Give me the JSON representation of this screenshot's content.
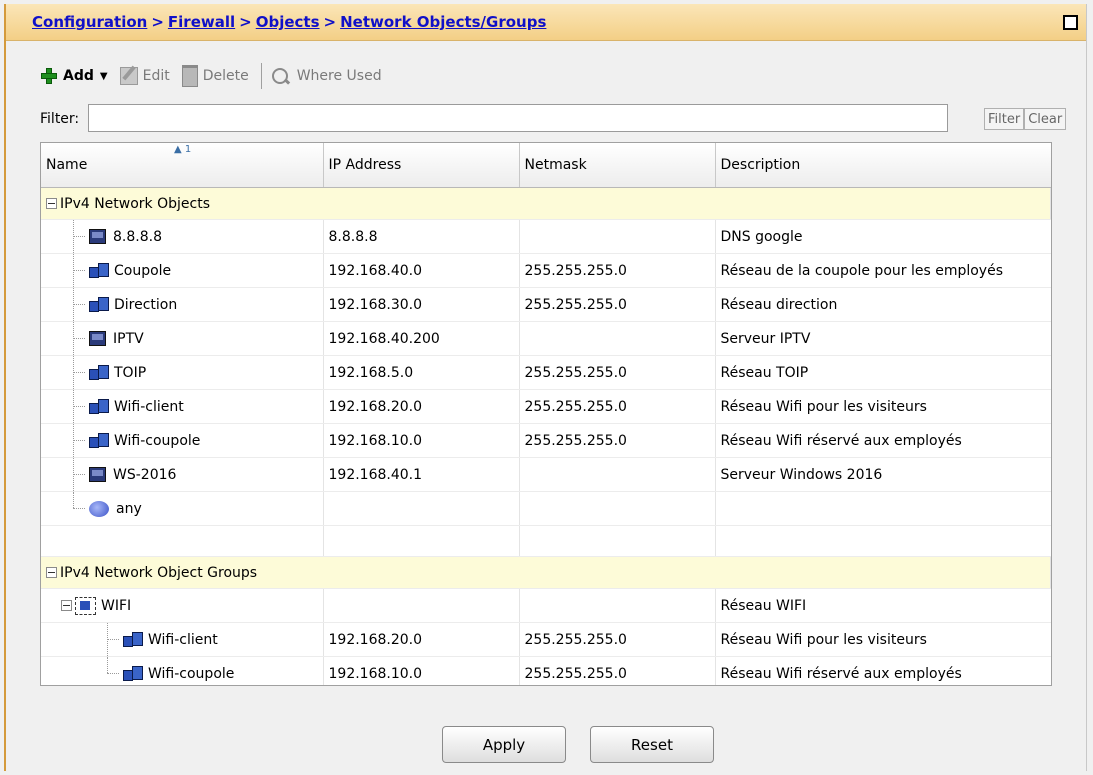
{
  "breadcrumb": {
    "items": [
      "Configuration",
      "Firewall",
      "Objects",
      "Network Objects/Groups"
    ],
    "separator": ">"
  },
  "toolbar": {
    "add_label": "Add",
    "edit_label": "Edit",
    "delete_label": "Delete",
    "where_used_label": "Where Used"
  },
  "filter": {
    "label": "Filter:",
    "value": "",
    "filter_button": "Filter",
    "clear_button": "Clear"
  },
  "table": {
    "columns": [
      "Name",
      "IP Address",
      "Netmask",
      "Description"
    ],
    "sort_indicator": "1",
    "groups": [
      {
        "title": "IPv4 Network Objects",
        "rows": [
          {
            "name": "8.8.8.8",
            "icon": "host-icon",
            "ip": "8.8.8.8",
            "netmask": "",
            "description": "DNS google"
          },
          {
            "name": "Coupole",
            "icon": "network-icon",
            "ip": "192.168.40.0",
            "netmask": "255.255.255.0",
            "description": "Réseau de la coupole pour les employés"
          },
          {
            "name": "Direction",
            "icon": "network-icon",
            "ip": "192.168.30.0",
            "netmask": "255.255.255.0",
            "description": "Réseau direction"
          },
          {
            "name": "IPTV",
            "icon": "host-icon",
            "ip": "192.168.40.200",
            "netmask": "",
            "description": "Serveur IPTV"
          },
          {
            "name": "TOIP",
            "icon": "network-icon",
            "ip": "192.168.5.0",
            "netmask": "255.255.255.0",
            "description": "Réseau TOIP"
          },
          {
            "name": "Wifi-client",
            "icon": "network-icon",
            "ip": "192.168.20.0",
            "netmask": "255.255.255.0",
            "description": "Réseau Wifi pour les visiteurs"
          },
          {
            "name": "Wifi-coupole",
            "icon": "network-icon",
            "ip": "192.168.10.0",
            "netmask": "255.255.255.0",
            "description": "Réseau Wifi réservé aux employés"
          },
          {
            "name": "WS-2016",
            "icon": "host-icon",
            "ip": "192.168.40.1",
            "netmask": "",
            "description": "Serveur Windows 2016"
          },
          {
            "name": "any",
            "icon": "any-icon",
            "ip": "",
            "netmask": "",
            "description": ""
          }
        ]
      },
      {
        "title": "IPv4 Network Object Groups",
        "group_row": {
          "name": "WIFI",
          "icon": "group-icon",
          "ip": "",
          "netmask": "",
          "description": "Réseau WIFI"
        },
        "rows": [
          {
            "name": "Wifi-client",
            "icon": "network-icon",
            "ip": "192.168.20.0",
            "netmask": "255.255.255.0",
            "description": "Réseau Wifi pour les visiteurs"
          },
          {
            "name": "Wifi-coupole",
            "icon": "network-icon",
            "ip": "192.168.10.0",
            "netmask": "255.255.255.0",
            "description": "Réseau Wifi réservé aux employés"
          }
        ]
      }
    ]
  },
  "actions": {
    "apply_label": "Apply",
    "reset_label": "Reset"
  },
  "colors": {
    "title_bar": "#f3cf86",
    "breadcrumb_link": "#1010c8",
    "group_row_bg": "#fdfbd8"
  }
}
